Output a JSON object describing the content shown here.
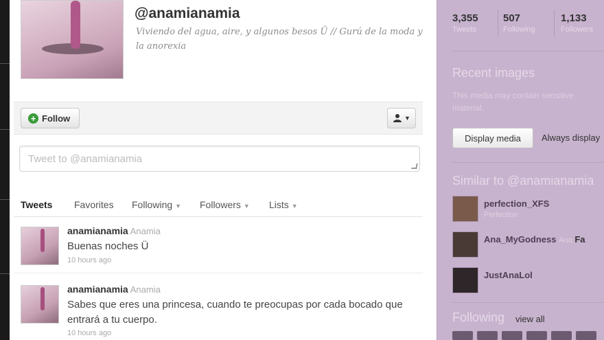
{
  "profile": {
    "screen_name": "@anamianamia",
    "bio": "Viviendo del agua, aire, y algunos besos Ü // Gurú de la moda y la anorexia"
  },
  "actions": {
    "follow_label": "Follow",
    "user_menu_icon": "user-icon"
  },
  "compose": {
    "placeholder": "Tweet to @anamianamia"
  },
  "tabs": [
    {
      "label": "Tweets",
      "active": true
    },
    {
      "label": "Favorites"
    },
    {
      "label": "Following"
    },
    {
      "label": "Followers"
    },
    {
      "label": "Lists"
    }
  ],
  "tweets": [
    {
      "user": "anamianamia",
      "name": "Anamia",
      "text": "Buenas noches Ü",
      "time": "10 hours ago"
    },
    {
      "user": "anamianamia",
      "name": "Anamia",
      "text": "Sabes que eres una princesa, cuando te preocupas por cada bocado que entrará a tu cuerpo.",
      "time": "10 hours ago"
    }
  ],
  "sidebar": {
    "stats": [
      {
        "value": "3,355",
        "label": "Tweets"
      },
      {
        "value": "507",
        "label": "Following"
      },
      {
        "value": "1,133",
        "label": "Followers"
      }
    ],
    "recent_images_title": "Recent images",
    "recent_images_sub": "This media may contain sensitive material.",
    "display_media_label": "Display media",
    "always_display_label": "Always display",
    "similar_title": "Similar to @anamianamia",
    "similar": [
      {
        "name": "perfection_XFS",
        "extra": "Perfection",
        "color": "#7a5a4a"
      },
      {
        "name": "Ana_MyGodness",
        "extra": "Ana",
        "extra2": "Fa",
        "color": "#4a3a36"
      },
      {
        "name": "JustAnaLol",
        "extra": "",
        "color": "#2e2628"
      }
    ],
    "following_title": "Following",
    "view_all_label": "view all"
  }
}
